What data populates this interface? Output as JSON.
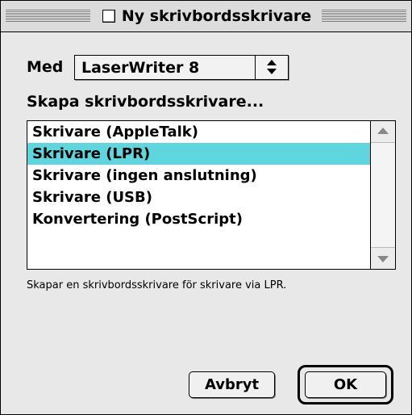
{
  "window": {
    "title": "Ny skrivbordsskrivare"
  },
  "driver": {
    "label": "Med",
    "selected": "LaserWriter 8",
    "icon": "popup-arrows-icon"
  },
  "section": {
    "label": "Skapa skrivbordsskrivare..."
  },
  "list": {
    "items": [
      {
        "label": "Skrivare (AppleTalk)",
        "selected": false
      },
      {
        "label": "Skrivare (LPR)",
        "selected": true
      },
      {
        "label": "Skrivare (ingen anslutning)",
        "selected": false
      },
      {
        "label": "Skrivare (USB)",
        "selected": false
      },
      {
        "label": "Konvertering (PostScript)",
        "selected": false
      }
    ],
    "selection_color": "#5fd5de"
  },
  "description": "Skapar en skrivbordsskrivare för skrivare via LPR.",
  "buttons": {
    "cancel": "Avbryt",
    "ok": "OK"
  }
}
